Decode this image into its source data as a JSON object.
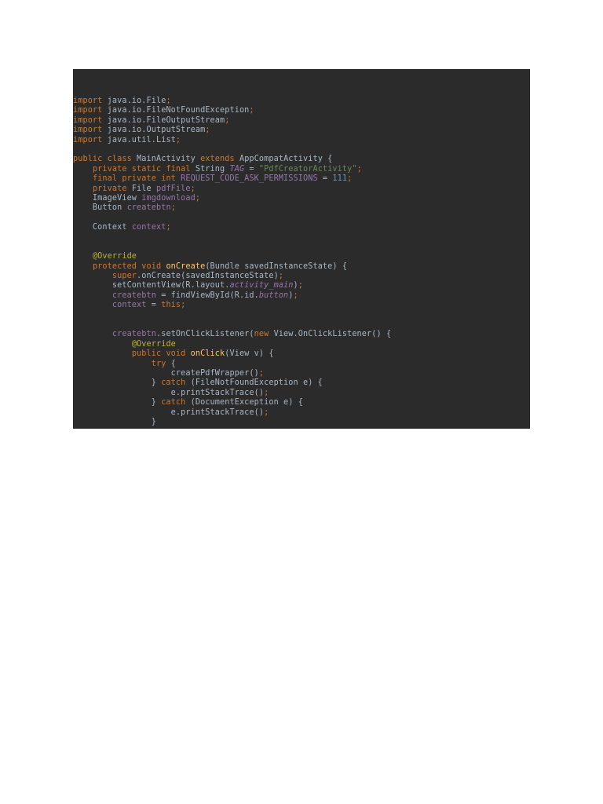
{
  "code": {
    "lines": [
      [
        [
          "kw",
          "import "
        ],
        [
          "txt",
          "java.io.File"
        ],
        [
          "kw",
          ";"
        ]
      ],
      [
        [
          "kw",
          "import "
        ],
        [
          "txt",
          "java.io.FileNotFoundException"
        ],
        [
          "kw",
          ";"
        ]
      ],
      [
        [
          "kw",
          "import "
        ],
        [
          "txt",
          "java.io.FileOutputStream"
        ],
        [
          "kw",
          ";"
        ]
      ],
      [
        [
          "kw",
          "import "
        ],
        [
          "txt",
          "java.io.OutputStream"
        ],
        [
          "kw",
          ";"
        ]
      ],
      [
        [
          "kw",
          "import "
        ],
        [
          "txt",
          "java.util.List"
        ],
        [
          "kw",
          ";"
        ]
      ],
      [],
      [
        [
          "kw",
          "public class "
        ],
        [
          "txt",
          "MainActivity "
        ],
        [
          "kw",
          "extends "
        ],
        [
          "txt",
          "AppCompatActivity {"
        ]
      ],
      [
        [
          "txt",
          "    "
        ],
        [
          "kw",
          "private static final "
        ],
        [
          "txt",
          "String "
        ],
        [
          "ital",
          "TAG"
        ],
        [
          "txt",
          " = "
        ],
        [
          "str",
          "\"PdfCreatorActivity\""
        ],
        [
          "kw",
          ";"
        ]
      ],
      [
        [
          "txt",
          "    "
        ],
        [
          "kw",
          "final private int "
        ],
        [
          "fld",
          "REQUEST_CODE_ASK_PERMISSIONS"
        ],
        [
          "txt",
          " = "
        ],
        [
          "num",
          "111"
        ],
        [
          "kw",
          ";"
        ]
      ],
      [
        [
          "txt",
          "    "
        ],
        [
          "kw",
          "private "
        ],
        [
          "txt",
          "File "
        ],
        [
          "fld",
          "pdfFile"
        ],
        [
          "kw",
          ";"
        ]
      ],
      [
        [
          "txt",
          "    ImageView "
        ],
        [
          "fld",
          "imgdownload"
        ],
        [
          "kw",
          ";"
        ]
      ],
      [
        [
          "txt",
          "    Button "
        ],
        [
          "fld",
          "createbtn"
        ],
        [
          "kw",
          ";"
        ]
      ],
      [],
      [
        [
          "txt",
          "    Context "
        ],
        [
          "fld",
          "context"
        ],
        [
          "kw",
          ";"
        ]
      ],
      [],
      [],
      [
        [
          "txt",
          "    "
        ],
        [
          "ann",
          "@Override"
        ]
      ],
      [
        [
          "txt",
          "    "
        ],
        [
          "kw",
          "protected void "
        ],
        [
          "fn",
          "onCreate"
        ],
        [
          "txt",
          "(Bundle savedInstanceState) {"
        ]
      ],
      [
        [
          "txt",
          "        "
        ],
        [
          "kw",
          "super"
        ],
        [
          "txt",
          ".onCreate(savedInstanceState)"
        ],
        [
          "kw",
          ";"
        ]
      ],
      [
        [
          "txt",
          "        setContentView(R.layout."
        ],
        [
          "ital",
          "activity_main"
        ],
        [
          "txt",
          ")"
        ],
        [
          "kw",
          ";"
        ]
      ],
      [
        [
          "txt",
          "        "
        ],
        [
          "fld",
          "createbtn"
        ],
        [
          "txt",
          " = findViewById(R.id."
        ],
        [
          "ital",
          "button"
        ],
        [
          "txt",
          ")"
        ],
        [
          "kw",
          ";"
        ]
      ],
      [
        [
          "txt",
          "        "
        ],
        [
          "fld",
          "context"
        ],
        [
          "txt",
          " = "
        ],
        [
          "kw",
          "this;"
        ]
      ],
      [],
      [],
      [
        [
          "txt",
          "        "
        ],
        [
          "fld",
          "createbtn"
        ],
        [
          "txt",
          ".setOnClickListener("
        ],
        [
          "kw",
          "new "
        ],
        [
          "txt",
          "View.OnClickListener() {"
        ]
      ],
      [
        [
          "txt",
          "            "
        ],
        [
          "ann",
          "@Override"
        ]
      ],
      [
        [
          "txt",
          "            "
        ],
        [
          "kw",
          "public void "
        ],
        [
          "fn",
          "onClick"
        ],
        [
          "txt",
          "(View v) {"
        ]
      ],
      [
        [
          "txt",
          "                "
        ],
        [
          "kw",
          "try "
        ],
        [
          "txt",
          "{"
        ]
      ],
      [
        [
          "txt",
          "                    createPdfWrapper()"
        ],
        [
          "kw",
          ";"
        ]
      ],
      [
        [
          "txt",
          "                } "
        ],
        [
          "kw",
          "catch "
        ],
        [
          "txt",
          "(FileNotFoundException e) {"
        ]
      ],
      [
        [
          "txt",
          "                    e.printStackTrace()"
        ],
        [
          "kw",
          ";"
        ]
      ],
      [
        [
          "txt",
          "                } "
        ],
        [
          "kw",
          "catch "
        ],
        [
          "txt",
          "(DocumentException e) {"
        ]
      ],
      [
        [
          "txt",
          "                    e.printStackTrace()"
        ],
        [
          "kw",
          ";"
        ]
      ],
      [
        [
          "txt",
          "                }"
        ]
      ]
    ]
  },
  "colors": {
    "background": "#2b2b2b",
    "keyword": "#cc7832",
    "string": "#6a8759",
    "field": "#9876aa",
    "annotation": "#bbb529",
    "method": "#ffc66d",
    "number": "#6897bb",
    "text": "#a9b7c6"
  }
}
